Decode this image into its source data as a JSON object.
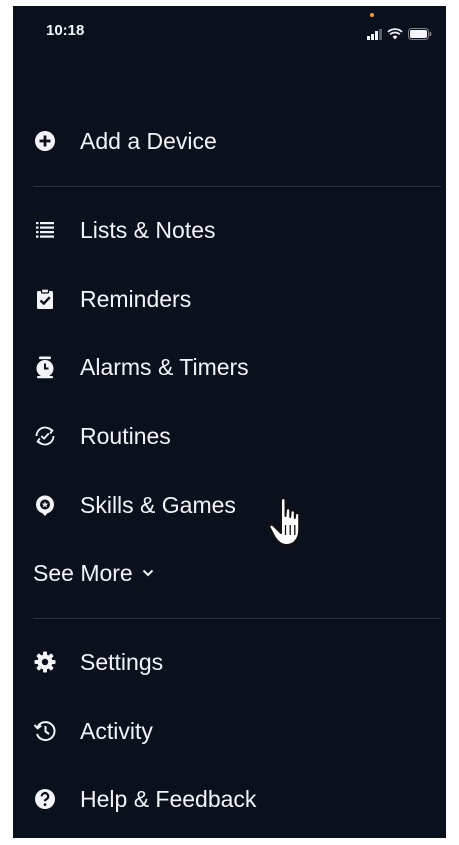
{
  "status_bar": {
    "time": "10:18",
    "icons": [
      "signal-icon",
      "wifi-icon",
      "battery-icon"
    ],
    "mic_indicator_color": "#f0a020"
  },
  "menu": {
    "add_device": {
      "label": "Add a Device",
      "icon": "plus-circle-icon"
    },
    "items": [
      {
        "label": "Lists & Notes",
        "icon": "list-icon"
      },
      {
        "label": "Reminders",
        "icon": "clipboard-check-icon"
      },
      {
        "label": "Alarms & Timers",
        "icon": "alarm-clock-icon"
      },
      {
        "label": "Routines",
        "icon": "routine-refresh-icon"
      },
      {
        "label": "Skills & Games",
        "icon": "skills-bubble-icon"
      }
    ],
    "see_more": {
      "label": "See More",
      "icon": "chevron-down-icon"
    },
    "bottom_items": [
      {
        "label": "Settings",
        "icon": "gear-icon"
      },
      {
        "label": "Activity",
        "icon": "history-icon"
      },
      {
        "label": "Help & Feedback",
        "icon": "help-circle-icon"
      }
    ]
  },
  "colors": {
    "background": "#0b111c",
    "text": "#f2f4f7",
    "divider": "#2c3340"
  },
  "pointer": {
    "icon": "hand-pointer-icon"
  }
}
